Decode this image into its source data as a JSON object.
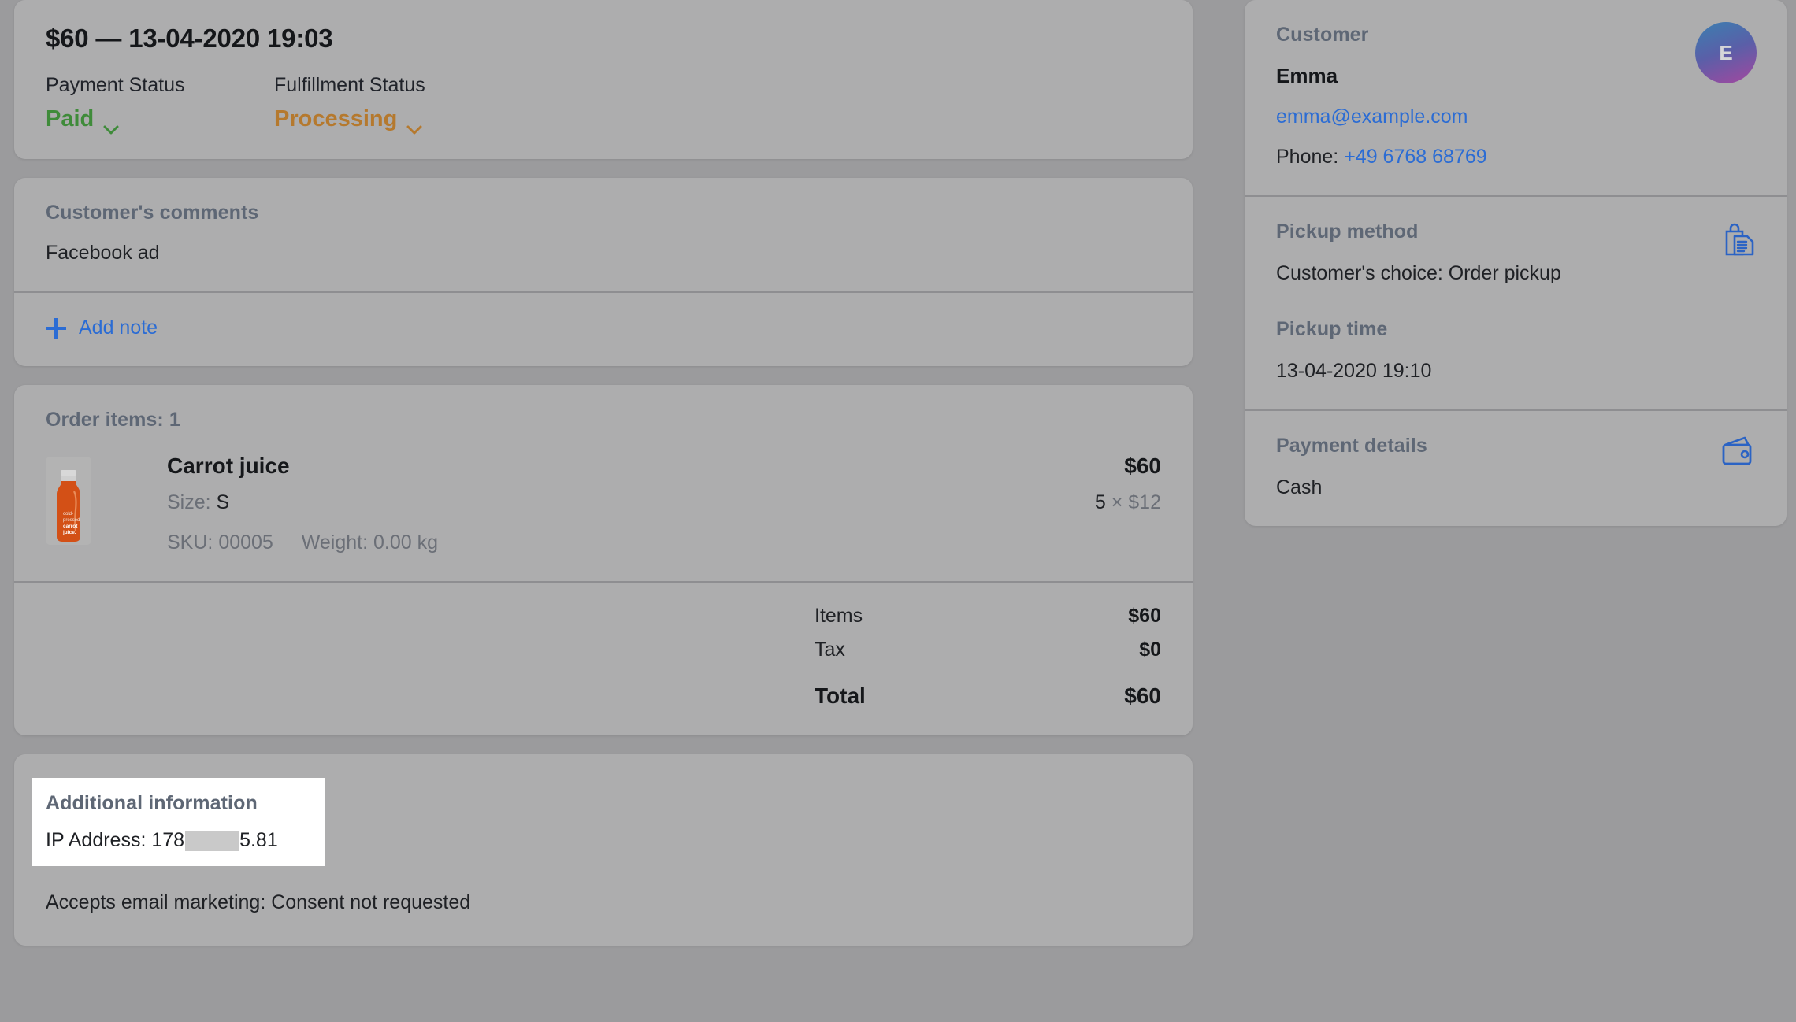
{
  "order_header": {
    "title": "$60 — 13-04-2020 19:03",
    "payment_status_label": "Payment Status",
    "payment_status_value": "Paid",
    "fulfillment_status_label": "Fulfillment Status",
    "fulfillment_status_value": "Processing",
    "paid_color": "#3f8b3a",
    "processing_color": "#b5792e"
  },
  "comments": {
    "title": "Customer's comments",
    "text": "Facebook ad",
    "add_note_label": "Add note"
  },
  "order_items": {
    "title": "Order items: 1",
    "items": [
      {
        "name": "Carrot juice",
        "size_label": "Size:",
        "size_value": "S",
        "sku_label": "SKU:",
        "sku_value": "00005",
        "weight_label": "Weight:",
        "weight_value": "0.00 kg",
        "price": "$60",
        "quantity": "5",
        "multiply": "×",
        "unit_price": "$12",
        "thumbnail_alt": "carrot-juice-bottle"
      }
    ],
    "totals": [
      {
        "label": "Items",
        "value": "$60"
      },
      {
        "label": "Tax",
        "value": "$0"
      }
    ],
    "grand_total": {
      "label": "Total",
      "value": "$60"
    }
  },
  "additional_information": {
    "title": "Additional information",
    "ip_prefix": "IP Address: 178",
    "ip_suffix": "5.81",
    "email_marketing": "Accepts email marketing: Consent not requested"
  },
  "customer": {
    "title": "Customer",
    "name": "Emma",
    "avatar_initial": "E",
    "email": "emma@example.com",
    "phone_label": "Phone:",
    "phone": "+49 6768 68769"
  },
  "pickup": {
    "method_title": "Pickup method",
    "method_value": "Customer's choice: Order pickup",
    "time_title": "Pickup time",
    "time_value": "13-04-2020 19:10",
    "icon": "shopping-bag-hand-icon"
  },
  "payment": {
    "title": "Payment details",
    "value": "Cash",
    "icon": "wallet-icon"
  },
  "colors": {
    "page_background": "#9b9b9d",
    "card_background": "#adadae",
    "link": "#2b6cd4",
    "section_heading": "#5e6775",
    "icon_blue": "#2b63c4"
  }
}
